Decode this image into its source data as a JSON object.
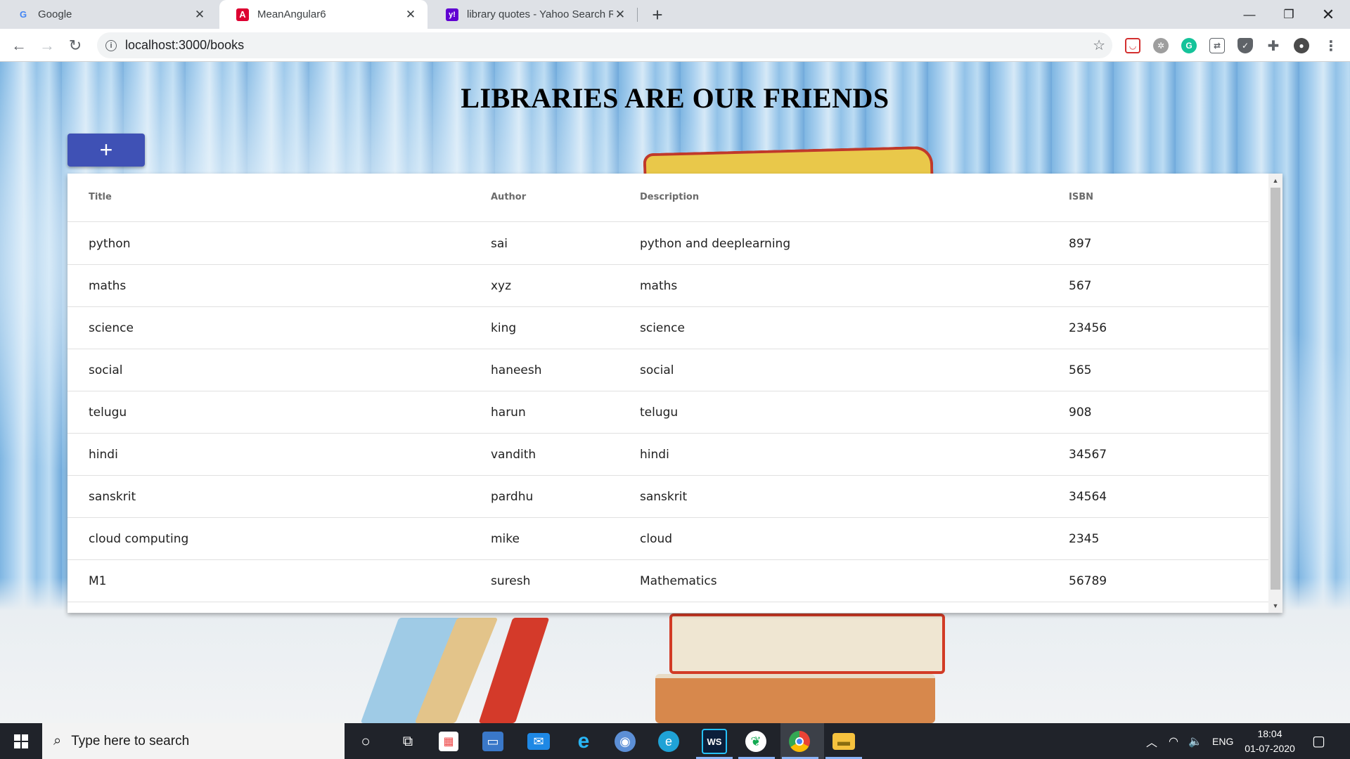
{
  "browser": {
    "tabs": [
      {
        "title": "Google",
        "favicon": "G"
      },
      {
        "title": "MeanAngular6",
        "favicon": "A"
      },
      {
        "title": "library quotes - Yahoo Search Re",
        "favicon": "y!"
      }
    ],
    "url": "localhost:3000/books"
  },
  "page": {
    "heading": "LIBRARIES ARE OUR FRIENDS",
    "add_button_label": "+"
  },
  "table": {
    "headers": {
      "title": "Title",
      "author": "Author",
      "description": "Description",
      "isbn": "ISBN"
    },
    "rows": [
      {
        "title": "python",
        "author": "sai",
        "description": "python and deeplearning",
        "isbn": "897"
      },
      {
        "title": "maths",
        "author": "xyz",
        "description": "maths",
        "isbn": "567"
      },
      {
        "title": "science",
        "author": "king",
        "description": "science",
        "isbn": "23456"
      },
      {
        "title": "social",
        "author": "haneesh",
        "description": "social",
        "isbn": "565"
      },
      {
        "title": "telugu",
        "author": "harun",
        "description": "telugu",
        "isbn": "908"
      },
      {
        "title": "hindi",
        "author": "vandith",
        "description": "hindi",
        "isbn": "34567"
      },
      {
        "title": "sanskrit",
        "author": "pardhu",
        "description": "sanskrit",
        "isbn": "34564"
      },
      {
        "title": "cloud computing",
        "author": "mike",
        "description": "cloud",
        "isbn": "2345"
      },
      {
        "title": "M1",
        "author": "suresh",
        "description": "Mathematics",
        "isbn": "56789"
      }
    ]
  },
  "taskbar": {
    "search_placeholder": "Type here to search",
    "language": "ENG",
    "time": "18:04",
    "date": "01-07-2020"
  },
  "colors": {
    "accent": "#3f51b5",
    "taskbar": "#20232a",
    "chrome_tabstrip": "#dee1e6"
  }
}
